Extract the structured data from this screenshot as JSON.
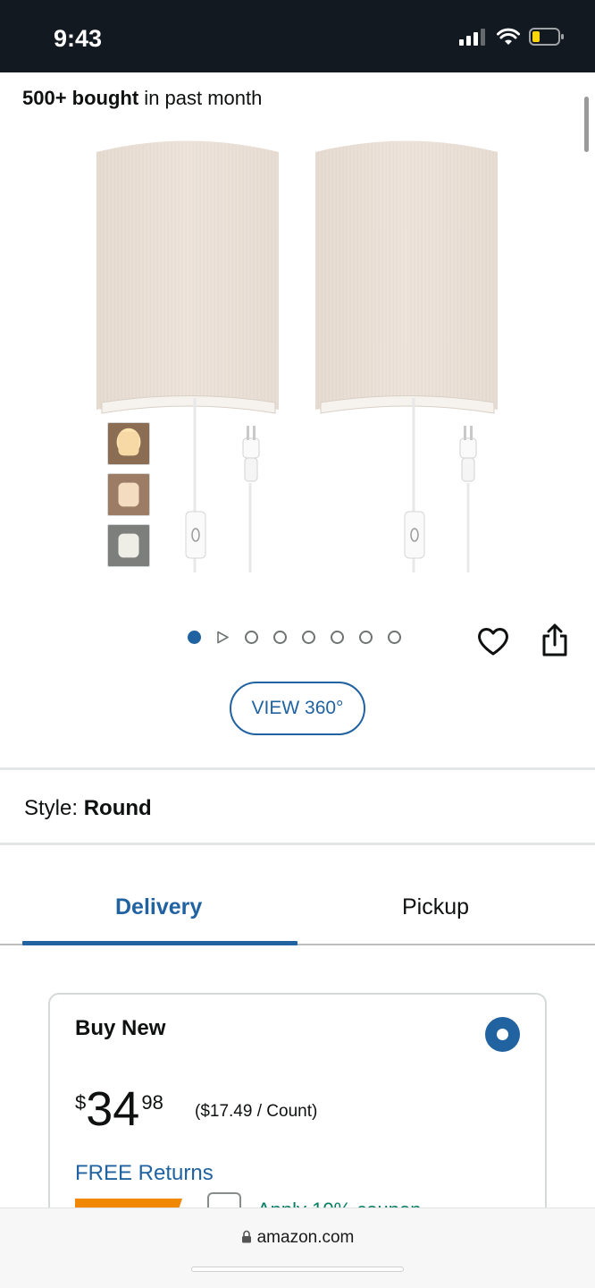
{
  "status_bar": {
    "time": "9:43"
  },
  "social_proof": {
    "count": "500+ bought",
    "suffix": " in past month"
  },
  "gallery": {
    "total_dots": 8,
    "active_index": 0,
    "view360_label": "VIEW 360°"
  },
  "style": {
    "label": "Style:",
    "value": "Round"
  },
  "tabs": {
    "delivery": "Delivery",
    "pickup": "Pickup",
    "active": "Delivery"
  },
  "buy_box": {
    "title": "Buy New",
    "selected": true,
    "price_symbol": "$",
    "price_whole": "34",
    "price_fraction": "98",
    "unit_price": "($17.49 / Count)",
    "returns_label": "FREE Returns",
    "coupon_text": "Apply 10% coupon"
  },
  "browser": {
    "url": "amazon.com"
  },
  "colors": {
    "link_blue": "#2162a1",
    "status_bar_bg": "#131921",
    "deal_orange": "#f08804",
    "coupon_green": "#067d62"
  },
  "icons": [
    "signal-icon",
    "wifi-icon",
    "battery-icon",
    "heart-icon",
    "share-icon",
    "play-icon",
    "lock-icon"
  ]
}
